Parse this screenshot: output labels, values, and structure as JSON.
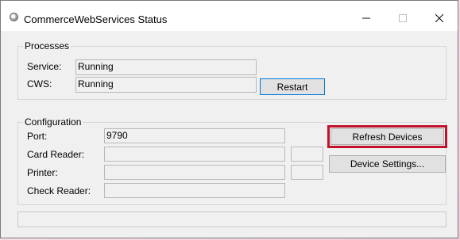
{
  "window": {
    "title": "CommerceWebServices Status"
  },
  "processes": {
    "label": "Processes",
    "service_label": "Service:",
    "service_value": "Running",
    "cws_label": "CWS:",
    "cws_value": "Running",
    "restart_button": "Restart"
  },
  "configuration": {
    "label": "Configuration",
    "port_label": "Port:",
    "port_value": "9790",
    "card_reader_label": "Card Reader:",
    "card_reader_value": "",
    "card_reader_extra": "",
    "printer_label": "Printer:",
    "printer_value": "",
    "printer_extra": "",
    "check_reader_label": "Check Reader:",
    "check_reader_value": "",
    "refresh_devices_button": "Refresh Devices",
    "device_settings_button": "Device Settings..."
  },
  "status_bar": {
    "text": ""
  },
  "colors": {
    "window_bg": "#f0f0f0",
    "focus_border": "#0078d7",
    "highlight_outline": "#c0132b"
  }
}
